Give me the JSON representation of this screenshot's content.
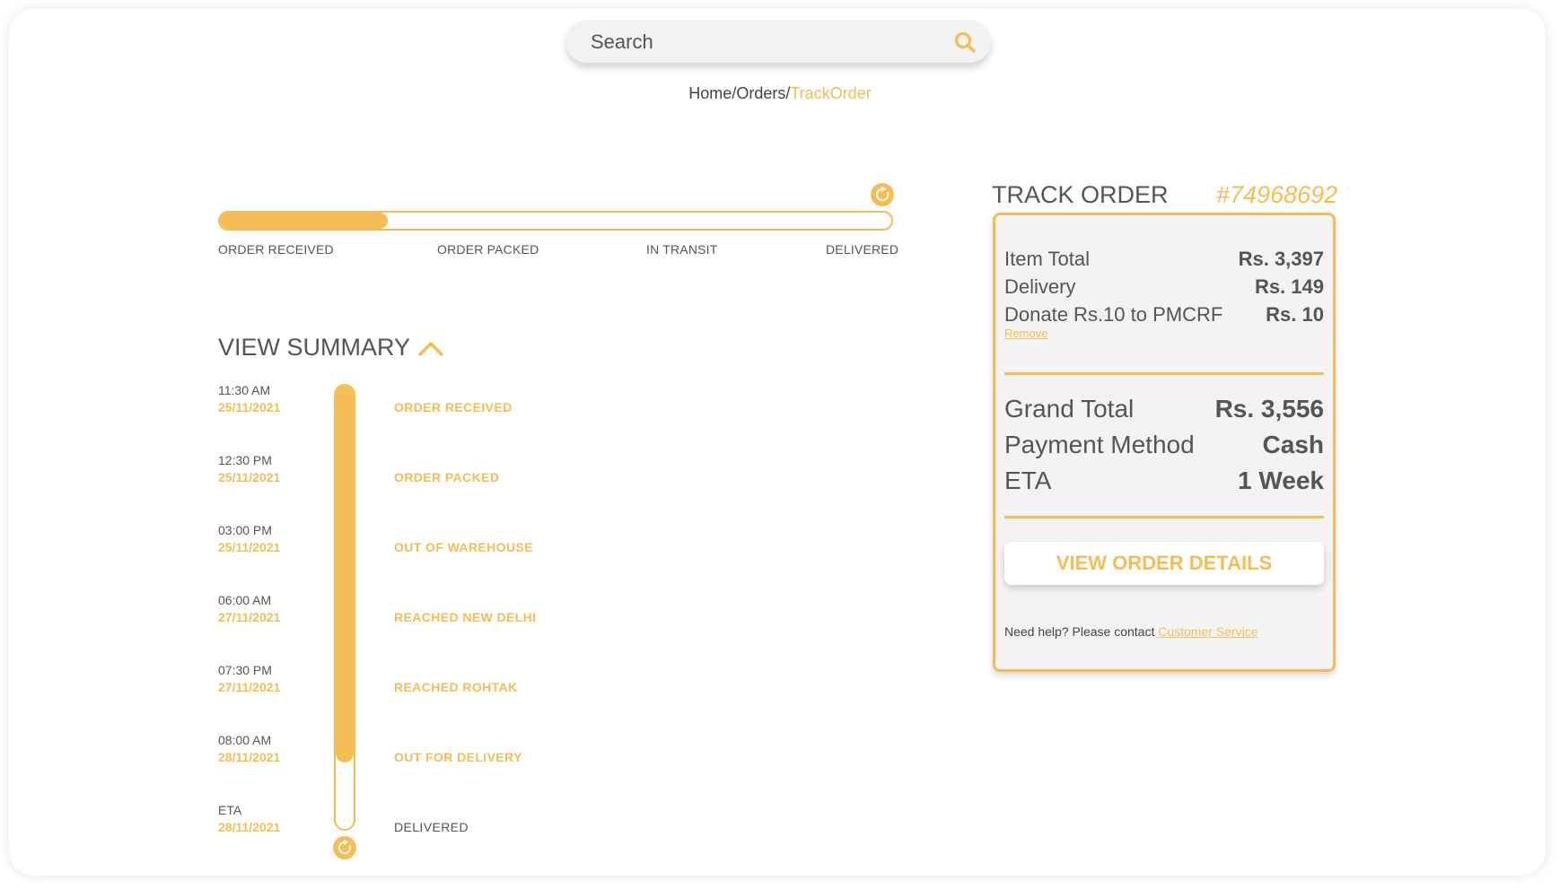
{
  "search": {
    "placeholder": "Search",
    "icon": "search-icon"
  },
  "breadcrumb": {
    "home": "Home",
    "sep1": "/",
    "orders": "Orders",
    "sep2": "/",
    "current": "TrackOrder"
  },
  "progress": {
    "fraction": 0.25,
    "stages": [
      "ORDER RECEIVED",
      "ORDER PACKED",
      "IN TRANSIT",
      "DELIVERED"
    ]
  },
  "summary": {
    "title": "VIEW SUMMARY",
    "completed_fraction": 0.85,
    "events": [
      {
        "time": "11:30 AM",
        "date": "25/11/2021",
        "status": "ORDER RECEIVED",
        "done": true
      },
      {
        "time": "12:30 PM",
        "date": "25/11/2021",
        "status": "ORDER PACKED",
        "done": true
      },
      {
        "time": "03:00 PM",
        "date": "25/11/2021",
        "status": "OUT OF WAREHOUSE",
        "done": true
      },
      {
        "time": "06:00 AM",
        "date": "27/11/2021",
        "status": "REACHED NEW DELHI",
        "done": true
      },
      {
        "time": "07:30 PM",
        "date": "27/11/2021",
        "status": "REACHED ROHTAK",
        "done": true
      },
      {
        "time": "08:00 AM",
        "date": "28/11/2021",
        "status": "OUT FOR DELIVERY",
        "done": true
      },
      {
        "time": "ETA",
        "date": "28/11/2021",
        "status": "DELIVERED",
        "done": false
      }
    ]
  },
  "card": {
    "title": "TRACK ORDER",
    "order_id": "#74968692",
    "item_total_label": "Item Total",
    "item_total": "Rs. 3,397",
    "delivery_label": "Delivery",
    "delivery": "Rs. 149",
    "donate_label": "Donate Rs.10 to PMCRF",
    "donate": "Rs. 10",
    "remove_label": "Remove",
    "grand_total_label": "Grand Total",
    "grand_total": "Rs. 3,556",
    "payment_label": "Payment Method",
    "payment": "Cash",
    "eta_label": "ETA",
    "eta": "1 Week",
    "details_button": "VIEW ORDER DETAILS",
    "help_text": "Need help? Please contact",
    "help_link": "Customer Service"
  },
  "colors": {
    "accent": "#f5bd55",
    "text": "#555555",
    "card_bg": "#f3f3f3"
  }
}
